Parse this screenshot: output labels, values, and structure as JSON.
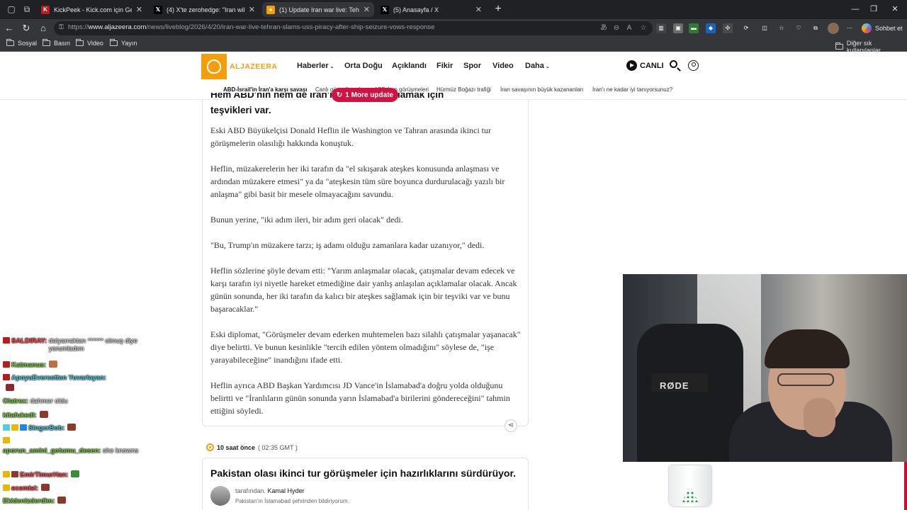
{
  "browser": {
    "tabs": [
      {
        "title": "KickPeek - Kick.com için Gerçek Za",
        "favicon": "kick-icon",
        "color": "#b91c1c",
        "active": false
      },
      {
        "title": "(4) X'te zerohedge: \"Iran willing to",
        "favicon": "x-icon",
        "color": "#000000",
        "active": false
      },
      {
        "title": "(1) Update Iran war live: Tehran wil",
        "favicon": "aljazeera-icon",
        "color": "#f59e0b",
        "active": true
      },
      {
        "title": "(5) Anasayfa / X",
        "favicon": "x-icon",
        "color": "#000000",
        "active": false
      }
    ],
    "url_prefix": "https://",
    "url_host": "www.aljazeera.com",
    "url_path": "/news/liveblog/2026/4/20/iran-war-live-tehran-slams-uss-piracy-after-ship-seizure-vows-response",
    "copilot_label": "Sohbet et",
    "bookmarks": [
      "Sosyal",
      "Basın",
      "Video",
      "Yayın"
    ],
    "other_bookmarks": "Diğer sık kullanılanlar"
  },
  "site": {
    "logo": "ALJAZEERA",
    "nav": [
      "Haberler",
      "Orta Doğu",
      "Açıklandı",
      "Fikir",
      "Spor",
      "Video",
      "Daha"
    ],
    "live_label": "CANLI",
    "topics": [
      "ABD-İsrail'in İran'a karşı savaşı",
      "Canlı güncellemeler",
      "ABD-İran görüşmeleri",
      "Hürmüz Boğazı trafiği",
      "İran savaşının büyük kazananları",
      "İran'ı ne kadar iyi tanıyorsunuz?"
    ],
    "more_update": "1 More update"
  },
  "article": {
    "heading_line1": "Hem ABD'nin hem de İran'ın ateşkesi sağlamak için",
    "heading_line2": "teşvikleri var.",
    "paragraphs": [
      "Eski ABD Büyükelçisi Donald Heflin ile Washington ve Tahran arasında ikinci tur görüşmelerin olasılığı hakkında konuştuk.",
      "Heflin, müzakerelerin her iki tarafın da \"el sıkışarak ateşkes konusunda anlaşması ve ardından müzakere etmesi\" ya da \"ateşkesin tüm süre boyunca durdurulacağı yazılı bir anlaşma\" gibi basit bir mesele olmayacağını savundu.",
      "Bunun yerine, \"iki adım ileri, bir adım geri olacak\" dedi.",
      "\"Bu, Trump'ın müzakere tarzı; iş adamı olduğu zamanlara kadar uzanıyor,\" dedi.",
      "Heflin sözlerine şöyle devam etti: \"Yarım anlaşmalar olacak, çatışmalar devam edecek ve karşı tarafın iyi niyetle hareket etmediğine dair yanlış anlaşılan açıklamalar olacak. Ancak günün sonunda, her iki tarafın da kalıcı bir ateşkes sağlamak için bir teşviki var ve bunu başaracaklar.\"",
      "Eski diplomat, \"Görüşmeler devam ederken muhtemelen bazı silahlı çatışmalar yaşanacak\" diye belirtti. Ve bunun kesinlikle \"tercih edilen yöntem olmadığını\" söylese de, \"işe yarayabileceğine\" inandığını ifade etti.",
      "Heflin ayrıca ABD Başkan Yardımcısı JD Vance'in İslamabad'a doğru yolda olduğunu belirtti ve \"İranlıların günün sonunda yarın İslamabad'a birilerini göndereceğini\" tahmin ettiğini söyledi."
    ]
  },
  "next_post": {
    "ago": "10 saat önce",
    "time": "( 02:35 GMT )",
    "heading": "Pakistan olası ikinci tur görüşmeler için hazırlıklarını sürdürüyor.",
    "by_label": "tarafından.",
    "author": "Kamal Hyder",
    "subline": "Pakistan'ın İslamabad şehrinden bildiriyorum."
  },
  "chat": [
    {
      "user": "SALDIRAY:",
      "msg": "dalyarraktan ****** olmuş diye yorumladım",
      "color": "#ff4d4d"
    },
    {
      "user": "Katmanus:",
      "msg": "",
      "color": "#ff4d4d"
    },
    {
      "user": "ApoyuEverestten Yuvarlayan:",
      "msg": "",
      "color": "#4dd0e1"
    },
    {
      "user": "Olatrex:",
      "msg": "dahmer oldu",
      "color": "#7cd142"
    },
    {
      "user": "kitafukedi:",
      "msg": "",
      "color": "#7cd142"
    },
    {
      "user": "SingerBob:",
      "msg": "",
      "color": "#4dd0e1"
    },
    {
      "user": "aporun_amini_gotumu_desen:",
      "msg": "she knowns",
      "color": "#7cd142"
    },
    {
      "user": "EmirTimurHan:",
      "msg": "",
      "color": "#ff4d4d"
    },
    {
      "user": "ecemisi:",
      "msg": "",
      "color": "#ff4d4d"
    },
    {
      "user": "Ekidenizderdim:",
      "msg": "",
      "color": "#7cd142"
    }
  ],
  "webcam_text": "RØDE"
}
